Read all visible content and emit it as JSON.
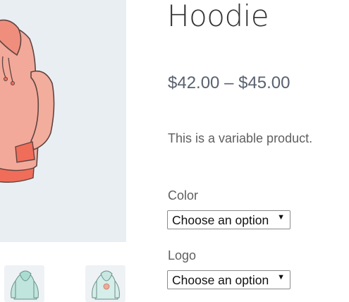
{
  "product": {
    "title": "Hoodie",
    "price": "$42.00 – $45.00",
    "description": "This is a variable product."
  },
  "variations": {
    "color": {
      "label": "Color",
      "selected": "Choose an option"
    },
    "logo": {
      "label": "Logo",
      "selected": "Choose an option"
    }
  },
  "icons": {
    "dropdown": "▼"
  },
  "colors": {
    "hoodie": "#f0a08c",
    "thumb_hoodie": "#a9ddd2",
    "gallery_bg": "#e9eef3"
  }
}
